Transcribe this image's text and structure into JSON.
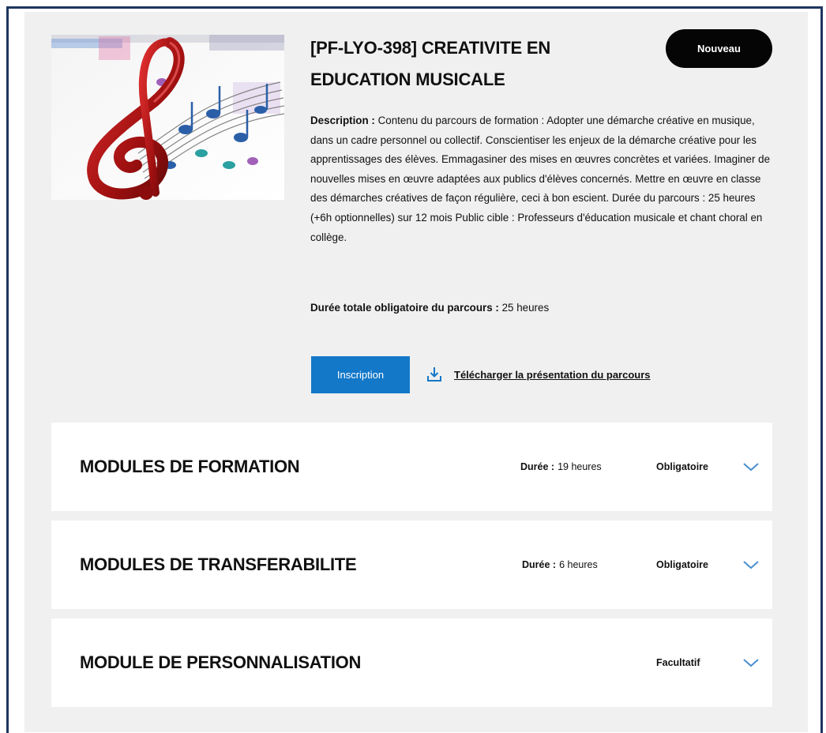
{
  "course": {
    "title": "[PF-LYO-398] CREATIVITE EN EDUCATION MUSICALE",
    "badge": "Nouveau",
    "description_label": "Description :",
    "description": "Contenu du parcours de formation : Adopter une démarche créative en musique, dans un cadre personnel ou collectif. Conscientiser les enjeux de la démarche créative pour les apprentissages des élèves. Emmagasiner des mises en œuvres concrètes et variées. Imaginer de nouvelles mises en œuvre adaptées aux publics d'élèves concernés. Mettre en œuvre en classe des démarches créatives de façon régulière, ceci à bon escient. Durée du parcours : 25 heures (+6h optionnelles) sur 12 mois Public cible : Professeurs d'éducation musicale et chant choral en collège.",
    "total_label": "Durée totale obligatoire du parcours :",
    "total_value": "25 heures",
    "register_label": "Inscription",
    "download_label": "Télécharger la présentation du parcours",
    "download_icon": "download-icon",
    "image_icon": "treble-clef-music-notes-image"
  },
  "modules": [
    {
      "title": "MODULES DE FORMATION",
      "duration_label": "Durée :",
      "duration_value": "19 heures",
      "requirement": "Obligatoire"
    },
    {
      "title": "MODULES DE TRANSFERABILITE",
      "duration_label": "Durée :",
      "duration_value": "6 heures",
      "requirement": "Obligatoire"
    },
    {
      "title": "MODULE DE PERSONNALISATION",
      "duration_label": "",
      "duration_value": "",
      "requirement": "Facultatif"
    }
  ],
  "colors": {
    "accent": "#1478c8",
    "chevron": "#4a90d0",
    "badge_bg": "#050505",
    "panel_bg": "#f0f0f0",
    "frame_border": "#1f3560"
  }
}
